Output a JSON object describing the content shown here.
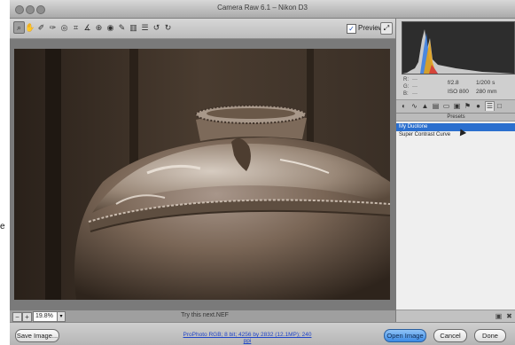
{
  "window": {
    "title": "Camera Raw 6.1  –  Nikon D3"
  },
  "toolbar": {
    "tools": [
      {
        "name": "zoom-tool-icon",
        "glyph": "⌕",
        "active": true
      },
      {
        "name": "hand-tool-icon",
        "glyph": "✋",
        "active": false
      },
      {
        "name": "white-balance-tool-icon",
        "glyph": "✐",
        "active": false
      },
      {
        "name": "color-sampler-tool-icon",
        "glyph": "✑",
        "active": false
      },
      {
        "name": "targeted-adjustment-tool-icon",
        "glyph": "◎",
        "active": false
      },
      {
        "name": "crop-tool-icon",
        "glyph": "⌗",
        "active": false
      },
      {
        "name": "straighten-tool-icon",
        "glyph": "∡",
        "active": false
      },
      {
        "name": "spot-removal-tool-icon",
        "glyph": "⊕",
        "active": false
      },
      {
        "name": "red-eye-tool-icon",
        "glyph": "◉",
        "active": false
      },
      {
        "name": "adjustment-brush-icon",
        "glyph": "✎",
        "active": false
      },
      {
        "name": "graduated-filter-icon",
        "glyph": "▥",
        "active": false
      },
      {
        "name": "preferences-icon",
        "glyph": "☰",
        "active": false
      },
      {
        "name": "rotate-left-icon",
        "glyph": "↺",
        "active": false
      },
      {
        "name": "rotate-right-icon",
        "glyph": "↻",
        "active": false
      }
    ],
    "preview_label": "Preview",
    "preview_checked": "✓",
    "fullscreen_glyph": "⤢"
  },
  "status": {
    "zoom_minus": "−",
    "zoom_plus": "+",
    "zoom_value": "19.8%",
    "zoom_arrow": "▾",
    "filename": "Try this next.NEF"
  },
  "readout": {
    "r_label": "R:",
    "g_label": "G:",
    "b_label": "B:",
    "r_value": "---",
    "g_value": "---",
    "b_value": "---",
    "aperture": "f/2.8",
    "shutter": "1/200 s",
    "iso": "ISO 800",
    "focal": "280 mm"
  },
  "panel_tabs": [
    {
      "name": "basic-tab-icon",
      "glyph": "◐",
      "active": false
    },
    {
      "name": "tone-curve-tab-icon",
      "glyph": "∿",
      "active": false
    },
    {
      "name": "detail-tab-icon",
      "glyph": "▲",
      "active": false
    },
    {
      "name": "hsl-tab-icon",
      "glyph": "▤",
      "active": false
    },
    {
      "name": "split-toning-tab-icon",
      "glyph": "▭",
      "active": false
    },
    {
      "name": "lens-corrections-tab-icon",
      "glyph": "▣",
      "active": false
    },
    {
      "name": "effects-tab-icon",
      "glyph": "⚑",
      "active": false
    },
    {
      "name": "camera-calibration-tab-icon",
      "glyph": "●",
      "active": false
    },
    {
      "name": "presets-tab-icon",
      "glyph": "☰",
      "active": true
    },
    {
      "name": "snapshots-tab-icon",
      "glyph": "□",
      "active": false
    }
  ],
  "presets_panel": {
    "title": "Presets",
    "items": [
      {
        "label": "My Duotone",
        "selected": true
      },
      {
        "label": "Super Contrast Curve",
        "selected": false
      }
    ],
    "new_preset_glyph": "▣",
    "delete_glyph": "✖"
  },
  "bottom": {
    "save_label": "Save Image...",
    "workflow_link": "ProPhoto RGB; 8 bit; 4256 by 2832 (12.1MP); 240 ppi",
    "open_label": "Open Image",
    "cancel_label": "Cancel",
    "done_label": "Done"
  },
  "external": {
    "label": "e"
  },
  "colors": {
    "accent": "#2b6fce",
    "photo_tone": "#6b5a4a"
  }
}
